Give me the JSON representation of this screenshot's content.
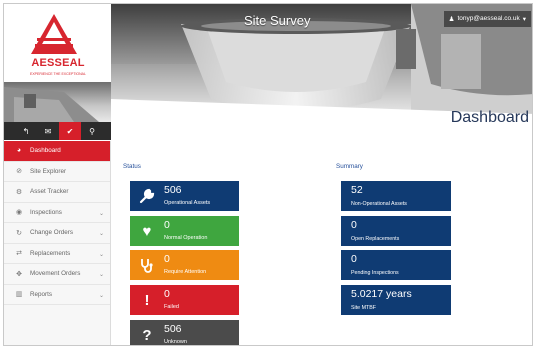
{
  "brand": {
    "name": "AESSEAL",
    "tagline": "EXPERIENCE THE EXCEPTIONAL",
    "color": "#d7262f"
  },
  "header": {
    "title": "Site Survey",
    "user_email": "tonyp@aesseal.co.uk",
    "user_icon": "person-icon",
    "caret_icon": "caret-down-icon",
    "page_title": "Dashboard"
  },
  "toolbar": {
    "buttons": [
      {
        "icon": "reply-icon",
        "glyph": "↰",
        "active": false
      },
      {
        "icon": "envelope-icon",
        "glyph": "✉",
        "active": false
      },
      {
        "icon": "bullhorn-icon",
        "glyph": "📢",
        "active": true
      },
      {
        "icon": "search-icon",
        "glyph": "⚲",
        "active": false
      }
    ]
  },
  "sidebar": {
    "items": [
      {
        "label": "Dashboard",
        "icon": "dashboard-icon",
        "glyph": "◕",
        "active": true,
        "has_submenu": false
      },
      {
        "label": "Site Explorer",
        "icon": "compass-icon",
        "glyph": "⊘",
        "active": false,
        "has_submenu": false
      },
      {
        "label": "Asset Tracker",
        "icon": "cogs-icon",
        "glyph": "⚙",
        "active": false,
        "has_submenu": false
      },
      {
        "label": "Inspections",
        "icon": "eye-icon",
        "glyph": "◉",
        "active": false,
        "has_submenu": true
      },
      {
        "label": "Change Orders",
        "icon": "refresh-icon",
        "glyph": "↻",
        "active": false,
        "has_submenu": true
      },
      {
        "label": "Replacements",
        "icon": "exchange-icon",
        "glyph": "⇄",
        "active": false,
        "has_submenu": true
      },
      {
        "label": "Movement Orders",
        "icon": "move-icon",
        "glyph": "✥",
        "active": false,
        "has_submenu": true
      },
      {
        "label": "Reports",
        "icon": "bar-chart-icon",
        "glyph": "▥",
        "active": false,
        "has_submenu": true
      }
    ]
  },
  "status": {
    "heading": "Status",
    "tiles": [
      {
        "value": "506",
        "label": "Operational Assets",
        "icon": "wrench-icon",
        "glyph": "🔧",
        "color": "#0f3b73"
      },
      {
        "value": "0",
        "label": "Normal Operation",
        "icon": "heart-icon",
        "glyph": "♥",
        "color": "#3fa63f"
      },
      {
        "value": "0",
        "label": "Require Attention",
        "icon": "stethoscope-icon",
        "glyph": "⚕",
        "color": "#ef8b12"
      },
      {
        "value": "0",
        "label": "Failed",
        "icon": "exclamation-icon",
        "glyph": "!",
        "color": "#d61f2a"
      },
      {
        "value": "506",
        "label": "Unknown",
        "icon": "question-icon",
        "glyph": "?",
        "color": "#4b4b4b"
      }
    ]
  },
  "summary": {
    "heading": "Summary",
    "tiles": [
      {
        "value": "52",
        "label": "Non-Operational Assets"
      },
      {
        "value": "0",
        "label": "Open Replacements"
      },
      {
        "value": "0",
        "label": "Pending Inspections"
      },
      {
        "value": "5.0217 years",
        "label": "Site MTBF"
      }
    ]
  }
}
